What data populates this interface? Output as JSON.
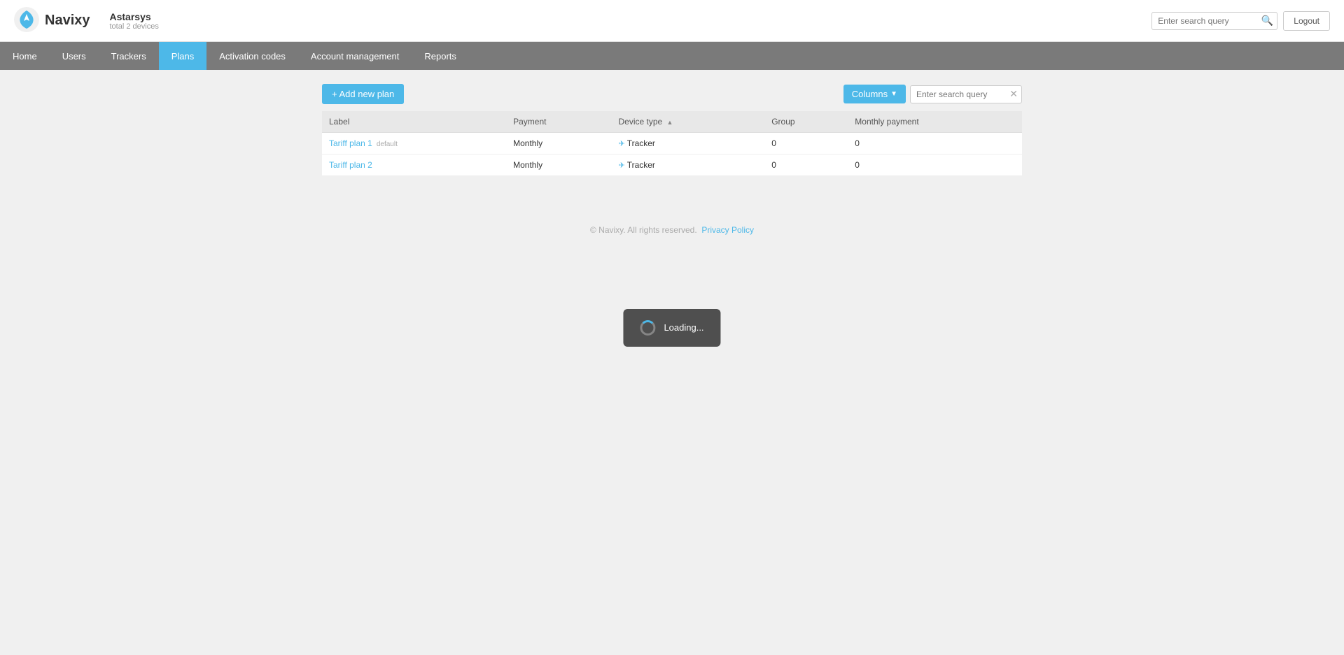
{
  "brand": {
    "name": "Navixy"
  },
  "account": {
    "name": "Astarsys",
    "devices_label": "total 2 devices"
  },
  "top_search": {
    "placeholder": "Enter search query"
  },
  "logout_button": "Logout",
  "nav": {
    "items": [
      {
        "id": "home",
        "label": "Home",
        "active": false
      },
      {
        "id": "users",
        "label": "Users",
        "active": false
      },
      {
        "id": "trackers",
        "label": "Trackers",
        "active": false
      },
      {
        "id": "plans",
        "label": "Plans",
        "active": true
      },
      {
        "id": "activation-codes",
        "label": "Activation codes",
        "active": false
      },
      {
        "id": "account-management",
        "label": "Account management",
        "active": false
      },
      {
        "id": "reports",
        "label": "Reports",
        "active": false
      }
    ]
  },
  "toolbar": {
    "add_button_label": "+ Add new plan",
    "columns_button_label": "Columns",
    "table_search_placeholder": "Enter search query"
  },
  "table": {
    "columns": [
      {
        "id": "label",
        "label": "Label",
        "sortable": false
      },
      {
        "id": "payment",
        "label": "Payment",
        "sortable": false
      },
      {
        "id": "device_type",
        "label": "Device type",
        "sortable": true
      },
      {
        "id": "group",
        "label": "Group",
        "sortable": false
      },
      {
        "id": "monthly_payment",
        "label": "Monthly payment",
        "sortable": false
      }
    ],
    "rows": [
      {
        "label": "Tariff plan 1",
        "default": true,
        "default_text": "default",
        "payment": "Monthly",
        "device_type": "Tracker",
        "group": "0",
        "monthly_payment": "0"
      },
      {
        "label": "Tariff plan 2",
        "default": false,
        "default_text": "",
        "payment": "Monthly",
        "device_type": "Tracker",
        "group": "0",
        "monthly_payment": "0"
      }
    ]
  },
  "loading": {
    "text": "Loading..."
  },
  "footer": {
    "text": "© Navixy. All rights reserved.",
    "privacy_policy_label": "Privacy Policy"
  }
}
